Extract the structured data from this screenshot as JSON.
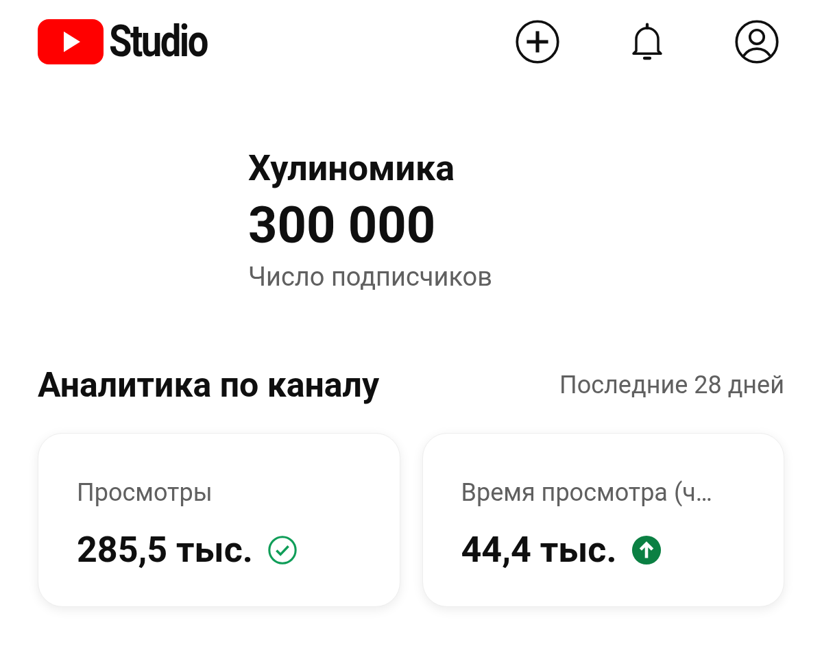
{
  "header": {
    "logo_text": "Studio"
  },
  "channel": {
    "name": "Хулиномика",
    "subscribers": "300 000",
    "subscribers_label": "Число подписчиков"
  },
  "analytics": {
    "title": "Аналитика по каналу",
    "period": "Последние 28 дней",
    "cards": [
      {
        "label": "Просмотры",
        "value": "285,5 тыс.",
        "kind": "check"
      },
      {
        "label": "Время просмотра (ч…",
        "value": "44,4 тыс.",
        "kind": "up"
      }
    ]
  }
}
